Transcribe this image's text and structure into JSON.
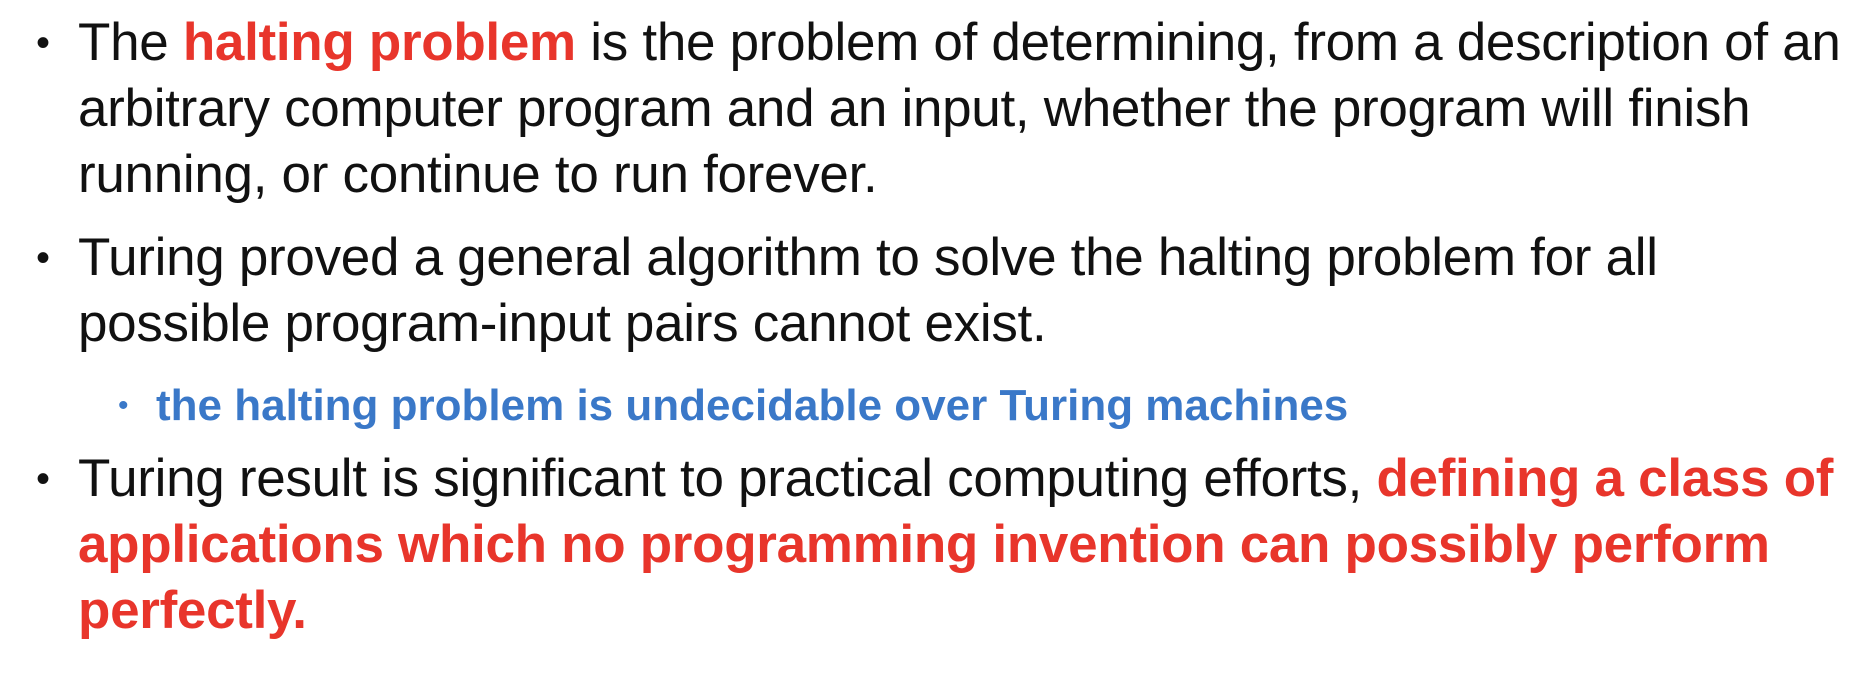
{
  "bullets": [
    {
      "pre": "The ",
      "highlight": "halting problem",
      "post": " is the problem of determining, from a description of an arbitrary computer program and an input, whether the program will finish running, or continue to run forever."
    },
    {
      "text": "Turing proved a general algorithm to solve the halting problem for all possible program-input pairs cannot exist.",
      "sub": "the halting problem is undecidable over Turing machines"
    },
    {
      "pre": "Turing result is significant to practical computing efforts, ",
      "highlight": "defining a class of applications which no programming invention can possibly perform perfectly."
    }
  ],
  "colors": {
    "highlight": "#e8352b",
    "sub_bullet": "#3a78c8",
    "text": "#111111"
  }
}
